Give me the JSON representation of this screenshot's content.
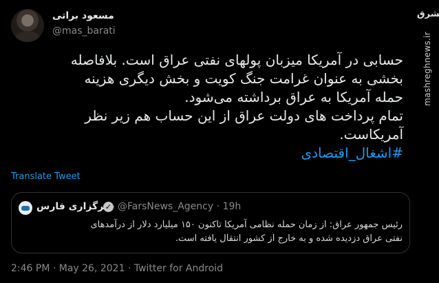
{
  "author": {
    "name": "مسعود براتی",
    "handle": "@mas_barati"
  },
  "tweet_lines": [
    "حسابی در آمریکا میزبان پولهای نفتی عراق است. بلافاصله",
    "بخشی به عنوان غرامت جنگ کویت و بخش دیگری هزینه",
    "حمله آمریکا به عراق برداشته می‌شود.",
    "تمام پرداخت های دولت عراق از این حساب هم زیر نظر",
    "آمریکاست."
  ],
  "hashtag": "#اشغال_اقتصادی",
  "translate_label": "Translate Tweet",
  "quote": {
    "name": "خبرگزاری فارس",
    "handle": "@FarsNews_Agency",
    "separator": "·",
    "time": "19h",
    "lines": [
      "رئیس جمهور عراق: از زمان حمله نظامی آمریکا تاکنون ۱۵۰ میلیارد دلار از درآمدهای",
      "نفتی عراق دزدیده شده و به خارج از کشور انتقال یافته است."
    ]
  },
  "footer": "2:46 PM · May 26, 2021 · Twitter for Android",
  "watermark": {
    "logo": "مشرق",
    "site": "mashreghnews.ir"
  },
  "icons": {
    "avatar": "profile-photo",
    "verified": "verified-badge-icon",
    "quote_avatar": "fars-news-logo"
  }
}
